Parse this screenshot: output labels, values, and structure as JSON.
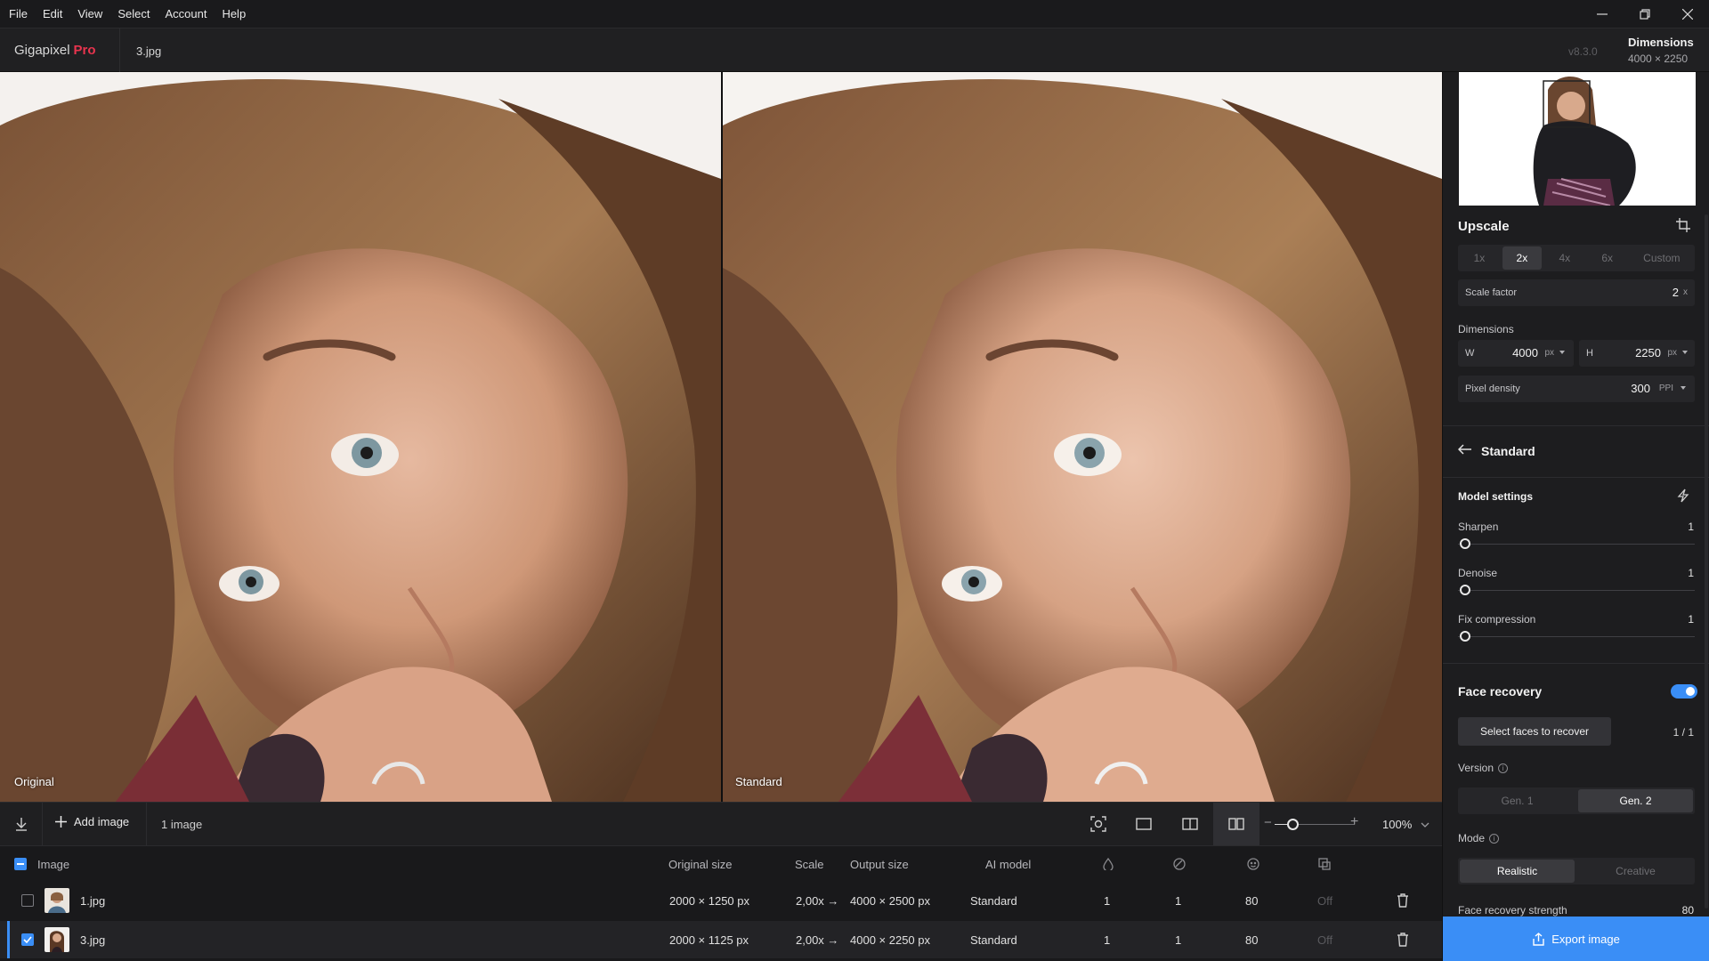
{
  "menu": [
    "File",
    "Edit",
    "View",
    "Select",
    "Account",
    "Help"
  ],
  "app": {
    "name": "Gigapixel",
    "edition": "Pro",
    "file_tab": "3.jpg",
    "version": "v8.3.0"
  },
  "header_dims": {
    "label": "Dimensions",
    "value": "4000 × 2250"
  },
  "preview": {
    "left_label": "Original",
    "right_label": "Standard"
  },
  "toolbar": {
    "add_label": "Add image",
    "count_label": "1 image",
    "zoom": "100%",
    "zoom_fraction": 0.22
  },
  "table": {
    "headers": {
      "image": "Image",
      "original": "Original size",
      "scale": "Scale",
      "output": "Output size",
      "model": "AI model"
    },
    "rows": [
      {
        "name": "1.jpg",
        "original": "2000 × 1250 px",
        "scale": "2,00x",
        "output": "4000 × 2500 px",
        "model": "Standard",
        "sharpen": "1",
        "denoise": "1",
        "face": "80",
        "off": "Off",
        "checked": false
      },
      {
        "name": "3.jpg",
        "original": "2000 × 1125 px",
        "scale": "2,00x",
        "output": "4000 × 2250 px",
        "model": "Standard",
        "sharpen": "1",
        "denoise": "1",
        "face": "80",
        "off": "Off",
        "checked": true
      }
    ]
  },
  "panel": {
    "upscale_title": "Upscale",
    "scale_options": [
      "1x",
      "2x",
      "4x",
      "6x",
      "Custom"
    ],
    "scale_active": "2x",
    "scale_factor_label": "Scale factor",
    "scale_factor_value": "2",
    "scale_factor_unit": "x",
    "dimensions_label": "Dimensions",
    "w_label": "W",
    "w_value": "4000",
    "w_unit": "px",
    "h_label": "H",
    "h_value": "2250",
    "h_unit": "px",
    "density_label": "Pixel density",
    "density_value": "300",
    "density_unit": "PPI",
    "model_title": "Standard",
    "model_settings_label": "Model settings",
    "sliders": [
      {
        "label": "Sharpen",
        "value": "1",
        "fraction": 0.01
      },
      {
        "label": "Denoise",
        "value": "1",
        "fraction": 0.01
      },
      {
        "label": "Fix compression",
        "value": "1",
        "fraction": 0.01
      }
    ],
    "face_recovery_label": "Face recovery",
    "select_faces_label": "Select faces to recover",
    "faces_count": "1 / 1",
    "version_label": "Version",
    "version_options": [
      "Gen. 1",
      "Gen. 2"
    ],
    "version_active": "Gen. 2",
    "mode_label": "Mode",
    "mode_options": [
      "Realistic",
      "Creative"
    ],
    "mode_active": "Realistic",
    "strength_label": "Face recovery strength",
    "strength_value": "80",
    "export_label": "Export image"
  },
  "colors": {
    "accent": "#3a8ef6",
    "pro": "#e8344e",
    "panel": "#1d1d1f"
  }
}
